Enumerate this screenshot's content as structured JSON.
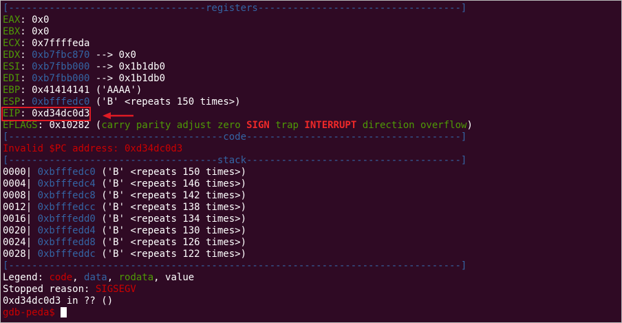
{
  "sep_registers": "[----------------------------------registers-----------------------------------]",
  "registers": [
    {
      "name": "EAX",
      "value": "0x0",
      "rest": ""
    },
    {
      "name": "EBX",
      "value": "0x0",
      "rest": ""
    },
    {
      "name": "ECX",
      "value": "0x7ffffeda",
      "rest": ""
    },
    {
      "name": "EDX",
      "value": "0xb7fbc870",
      "rest": " --> 0x0"
    },
    {
      "name": "ESI",
      "value": "0xb7fbb000",
      "rest": " --> 0x1b1db0"
    },
    {
      "name": "EDI",
      "value": "0xb7fbb000",
      "rest": " --> 0x1b1db0"
    },
    {
      "name": "EBP",
      "value": "0x41414141",
      "rest": " ('AAAA')"
    },
    {
      "name": "ESP",
      "value": "0xbfffedc0",
      "rest": " ('B' <repeats 150 times>)"
    },
    {
      "name": "EIP",
      "value": "0xd34dc0d3",
      "rest": ""
    }
  ],
  "eflags": {
    "name": "EFLAGS",
    "value": "0x10282",
    "open": " (",
    "flags": [
      "carry",
      "parity",
      "adjust",
      "zero",
      "SIGN",
      "trap",
      "INTERRUPT",
      "direction",
      "overflow"
    ],
    "close": ")"
  },
  "sep_code": "[-------------------------------------code-------------------------------------]",
  "code_error": "Invalid $PC address: 0xd34dc0d3",
  "sep_stack": "[------------------------------------stack-------------------------------------]",
  "stack": [
    {
      "offset": "0000",
      "addr": "0xbfffedc0",
      "content": " ('B' <repeats 150 times>)"
    },
    {
      "offset": "0004",
      "addr": "0xbfffedc4",
      "content": " ('B' <repeats 146 times>)"
    },
    {
      "offset": "0008",
      "addr": "0xbfffedc8",
      "content": " ('B' <repeats 142 times>)"
    },
    {
      "offset": "0012",
      "addr": "0xbfffedcc",
      "content": " ('B' <repeats 138 times>)"
    },
    {
      "offset": "0016",
      "addr": "0xbfffedd0",
      "content": " ('B' <repeats 134 times>)"
    },
    {
      "offset": "0020",
      "addr": "0xbfffedd4",
      "content": " ('B' <repeats 130 times>)"
    },
    {
      "offset": "0024",
      "addr": "0xbfffedd8",
      "content": " ('B' <repeats 126 times>)"
    },
    {
      "offset": "0028",
      "addr": "0xbfffeddc",
      "content": " ('B' <repeats 122 times>)"
    }
  ],
  "sep_end": "[------------------------------------------------------------------------------]",
  "legend": {
    "prefix": "Legend: ",
    "code": "code",
    "data": "data",
    "rodata": "rodata",
    "value": "value"
  },
  "stopped": {
    "label": "Stopped reason: ",
    "reason": "SIGSEGV"
  },
  "frame": "0xd34dc0d3 in ?? ()",
  "prompt": "gdb-peda$ ",
  "colors": {
    "background": "#2f0a24",
    "green": "#4e9a06",
    "blue": "#3465a4",
    "red": "#cc0000",
    "highlight": "#e01b24"
  }
}
